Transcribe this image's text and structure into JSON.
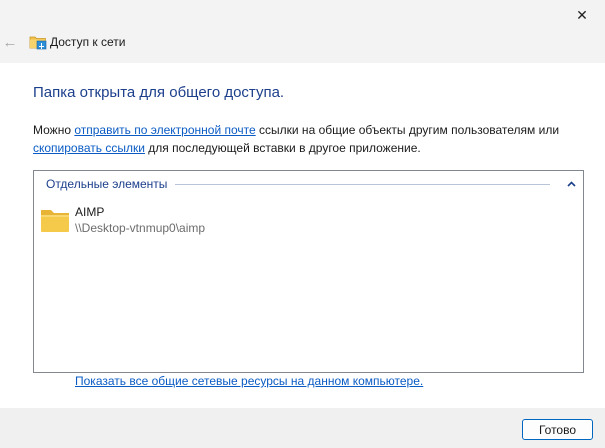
{
  "window": {
    "title": "Доступ к сети",
    "close_glyph": "✕",
    "back_glyph": "←"
  },
  "main": {
    "heading": "Папка открыта для общего доступа.",
    "desc_prefix": "Можно ",
    "email_link": "отправить по электронной почте",
    "desc_middle": " ссылки на общие объекты другим пользователям или ",
    "copy_link": "скопировать ссылки",
    "desc_suffix": " для последующей вставки в другое приложение."
  },
  "list": {
    "group_title": "Отдельные элементы",
    "items": [
      {
        "name": "AIMP",
        "path": "\\\\Desktop-vtnmup0\\aimp",
        "icon": "folder-icon"
      }
    ]
  },
  "show_all_link": "Показать все общие сетевые ресурсы на данном компьютере.",
  "footer": {
    "done_label": "Готово"
  },
  "colors": {
    "heading": "#1c3f8c",
    "link": "#0a5bc4",
    "titlebar_bg": "#f3f3f3",
    "folder": "#f5c94a",
    "accent": "#0067c0"
  }
}
